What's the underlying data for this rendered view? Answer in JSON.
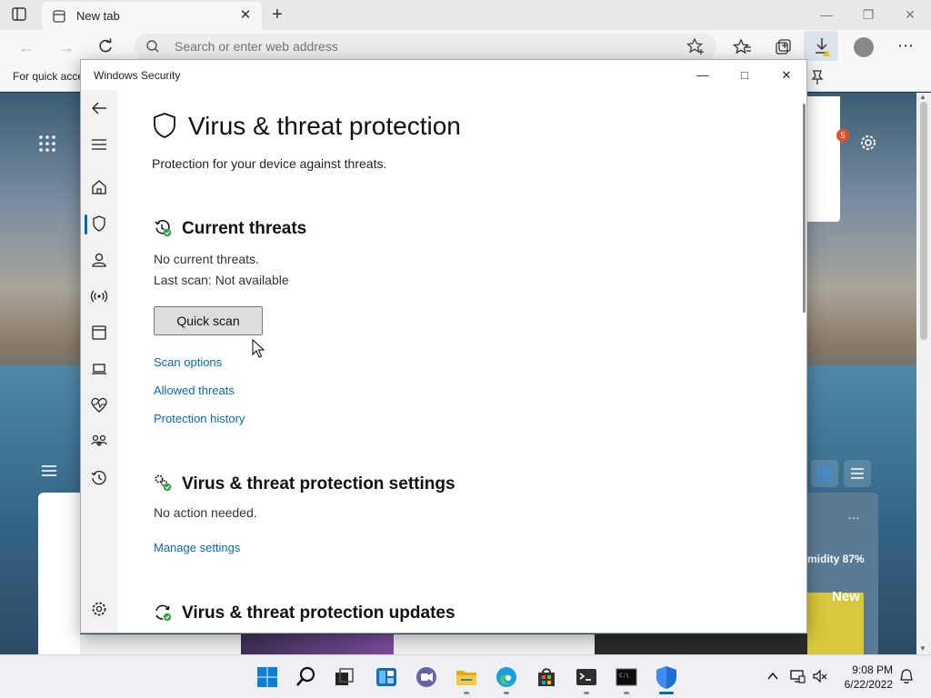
{
  "browser": {
    "tab_title": "New tab",
    "address_placeholder": "Search or enter web address",
    "favorites_text": "For quick acce"
  },
  "new_tab": {
    "humidity": "midity 87%",
    "news_label": "New",
    "badge_count": "5",
    "more_options": "…"
  },
  "window": {
    "title": "Windows Security",
    "controls": {
      "minimize": "—",
      "maximize": "□",
      "close": "✕"
    }
  },
  "page": {
    "title": "Virus & threat protection",
    "subtitle": "Protection for your device against threats."
  },
  "current_threats": {
    "title": "Current threats",
    "status": "No current threats.",
    "last_scan": "Last scan: Not available",
    "quick_scan_label": "Quick scan",
    "links": [
      "Scan options",
      "Allowed threats",
      "Protection history"
    ]
  },
  "settings": {
    "title": "Virus & threat protection settings",
    "status": "No action needed.",
    "link": "Manage settings"
  },
  "updates": {
    "title": "Virus & threat protection updates"
  },
  "sidebar": {
    "items": [
      "back",
      "menu",
      "home",
      "virus-protection",
      "account-protection",
      "firewall-network",
      "app-browser-control",
      "device-security",
      "device-performance",
      "family-options",
      "protection-history",
      "settings"
    ],
    "active": "virus-protection"
  },
  "taskbar": {
    "apps": [
      "start",
      "search",
      "task-view",
      "widgets",
      "chat",
      "file-explorer",
      "edge",
      "store",
      "terminal",
      "command-prompt",
      "windows-security"
    ],
    "time": "9:08 PM",
    "date": "6/22/2022"
  },
  "colors": {
    "accent": "#0067c0",
    "link": "#0a6aa8",
    "shield_green": "#2ea043"
  }
}
